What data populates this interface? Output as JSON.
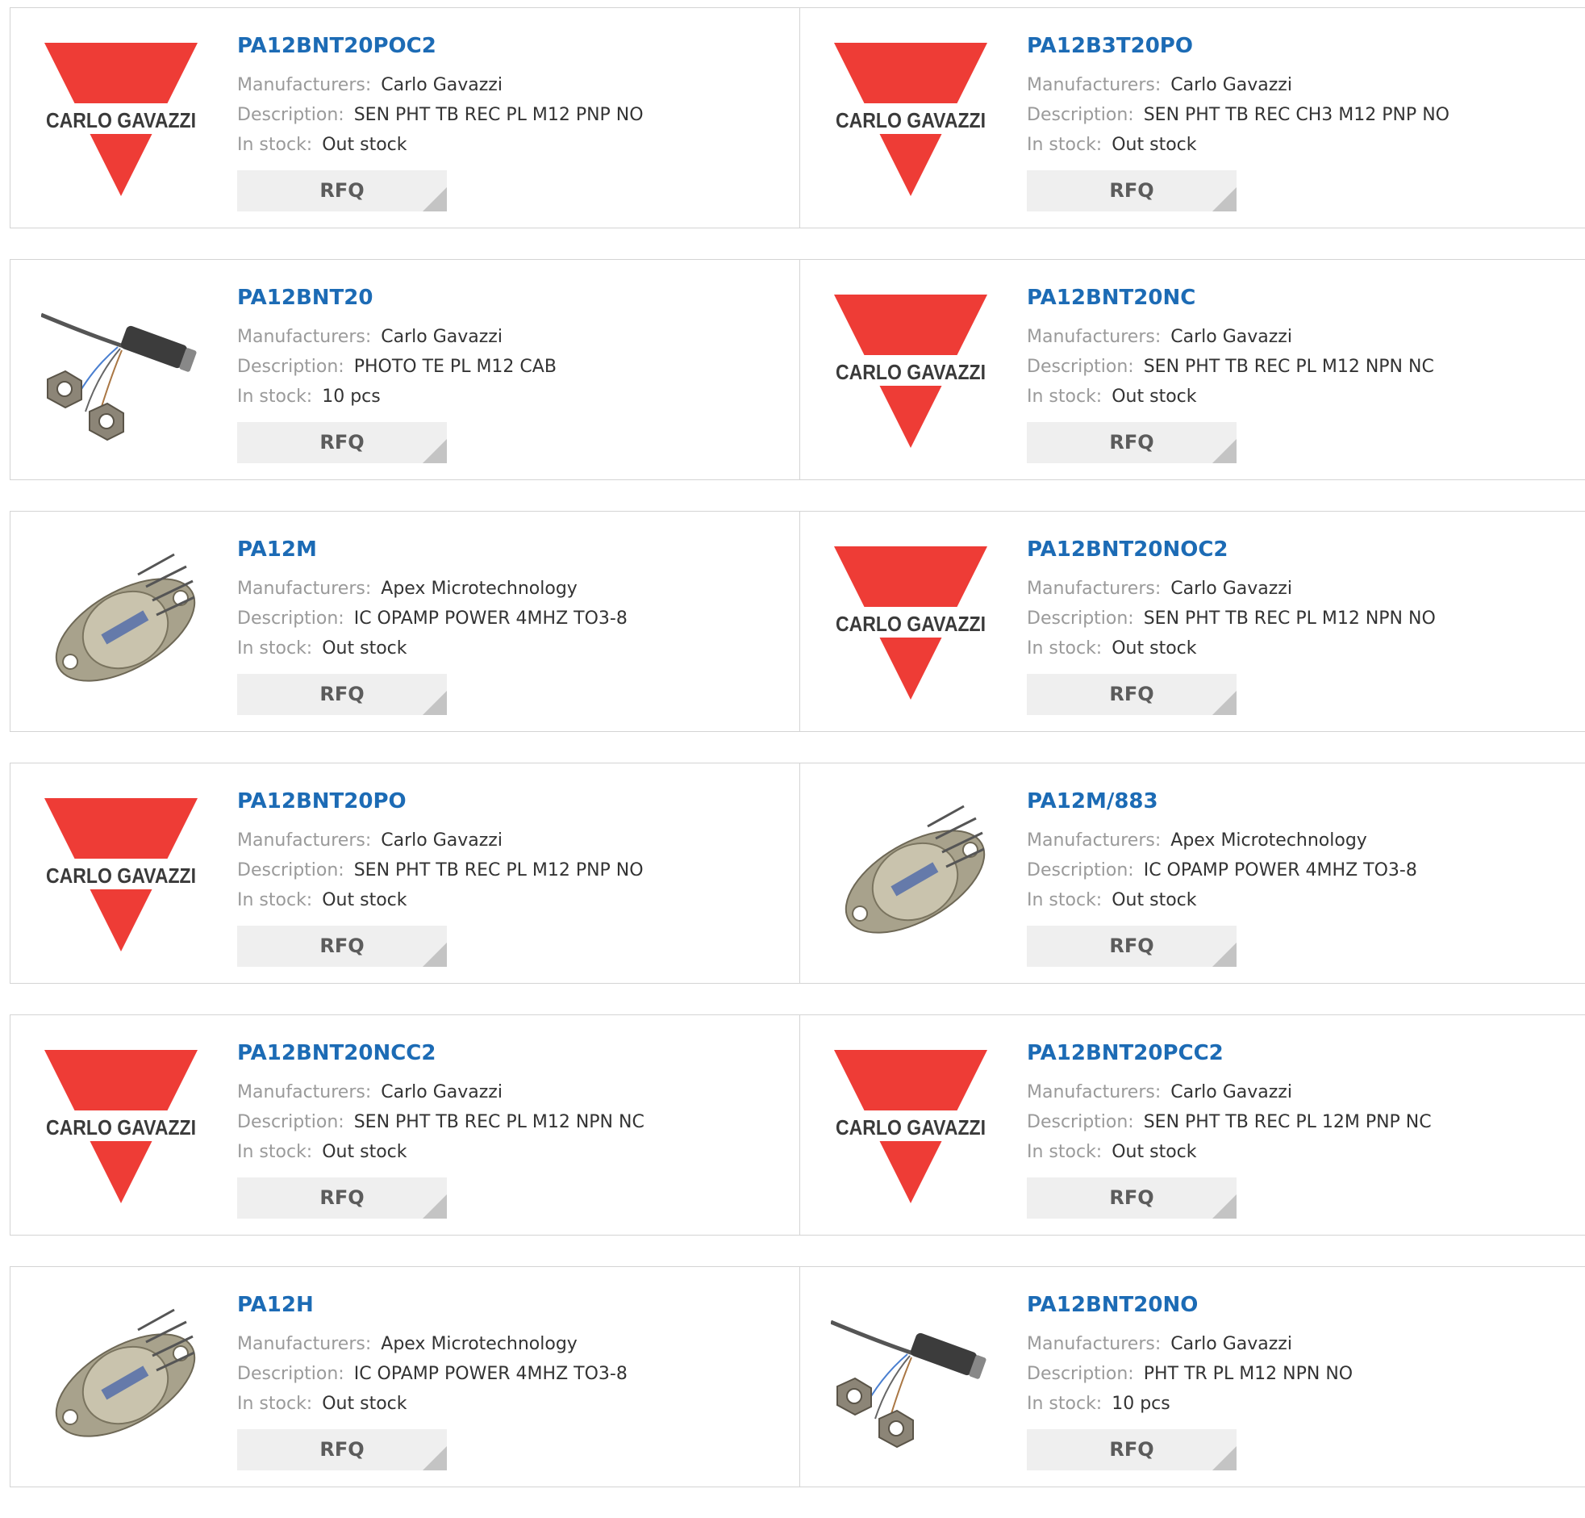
{
  "labels": {
    "manufacturers": "Manufacturers:",
    "description": "Description:",
    "in_stock": "In stock:",
    "rfq": "RFQ"
  },
  "logo_text": "CARLO GAVAZZI",
  "products": [
    {
      "name": "PA12BNT20POC2",
      "manufacturer": "Carlo Gavazzi",
      "description": "SEN PHT TB REC PL M12 PNP NO",
      "stock": "Out stock",
      "image": "carlo-gavazzi-logo"
    },
    {
      "name": "PA12B3T20PO",
      "manufacturer": "Carlo Gavazzi",
      "description": "SEN PHT TB REC CH3 M12 PNP NO",
      "stock": "Out stock",
      "image": "carlo-gavazzi-logo"
    },
    {
      "name": "PA12BNT20",
      "manufacturer": "Carlo Gavazzi",
      "description": "PHOTO TE PL M12 CAB",
      "stock": "10 pcs",
      "image": "photo-sensor-cable"
    },
    {
      "name": "PA12BNT20NC",
      "manufacturer": "Carlo Gavazzi",
      "description": "SEN PHT TB REC PL M12 NPN NC",
      "stock": "Out stock",
      "image": "carlo-gavazzi-logo"
    },
    {
      "name": "PA12M",
      "manufacturer": "Apex Microtechnology",
      "description": "IC OPAMP POWER 4MHZ TO3-8",
      "stock": "Out stock",
      "image": "to3-package"
    },
    {
      "name": "PA12BNT20NOC2",
      "manufacturer": "Carlo Gavazzi",
      "description": "SEN PHT TB REC PL M12 NPN NO",
      "stock": "Out stock",
      "image": "carlo-gavazzi-logo"
    },
    {
      "name": "PA12BNT20PO",
      "manufacturer": "Carlo Gavazzi",
      "description": "SEN PHT TB REC PL M12 PNP NO",
      "stock": "Out stock",
      "image": "carlo-gavazzi-logo"
    },
    {
      "name": "PA12M/883",
      "manufacturer": "Apex Microtechnology",
      "description": "IC OPAMP POWER 4MHZ TO3-8",
      "stock": "Out stock",
      "image": "to3-package"
    },
    {
      "name": "PA12BNT20NCC2",
      "manufacturer": "Carlo Gavazzi",
      "description": "SEN PHT TB REC PL M12 NPN NC",
      "stock": "Out stock",
      "image": "carlo-gavazzi-logo"
    },
    {
      "name": "PA12BNT20PCC2",
      "manufacturer": "Carlo Gavazzi",
      "description": "SEN PHT TB REC PL 12M PNP NC",
      "stock": "Out stock",
      "image": "carlo-gavazzi-logo"
    },
    {
      "name": "PA12H",
      "manufacturer": "Apex Microtechnology",
      "description": "IC OPAMP POWER 4MHZ TO3-8",
      "stock": "Out stock",
      "image": "to3-package"
    },
    {
      "name": "PA12BNT20NO",
      "manufacturer": "Carlo Gavazzi",
      "description": "PHT TR PL M12 NPN NO",
      "stock": "10 pcs",
      "image": "photo-sensor-cable"
    }
  ],
  "colors": {
    "link": "#1c6bb5",
    "logo_red": "#ee3c36",
    "label_gray": "#9a9a9a",
    "rfq_bg": "#efefef"
  }
}
